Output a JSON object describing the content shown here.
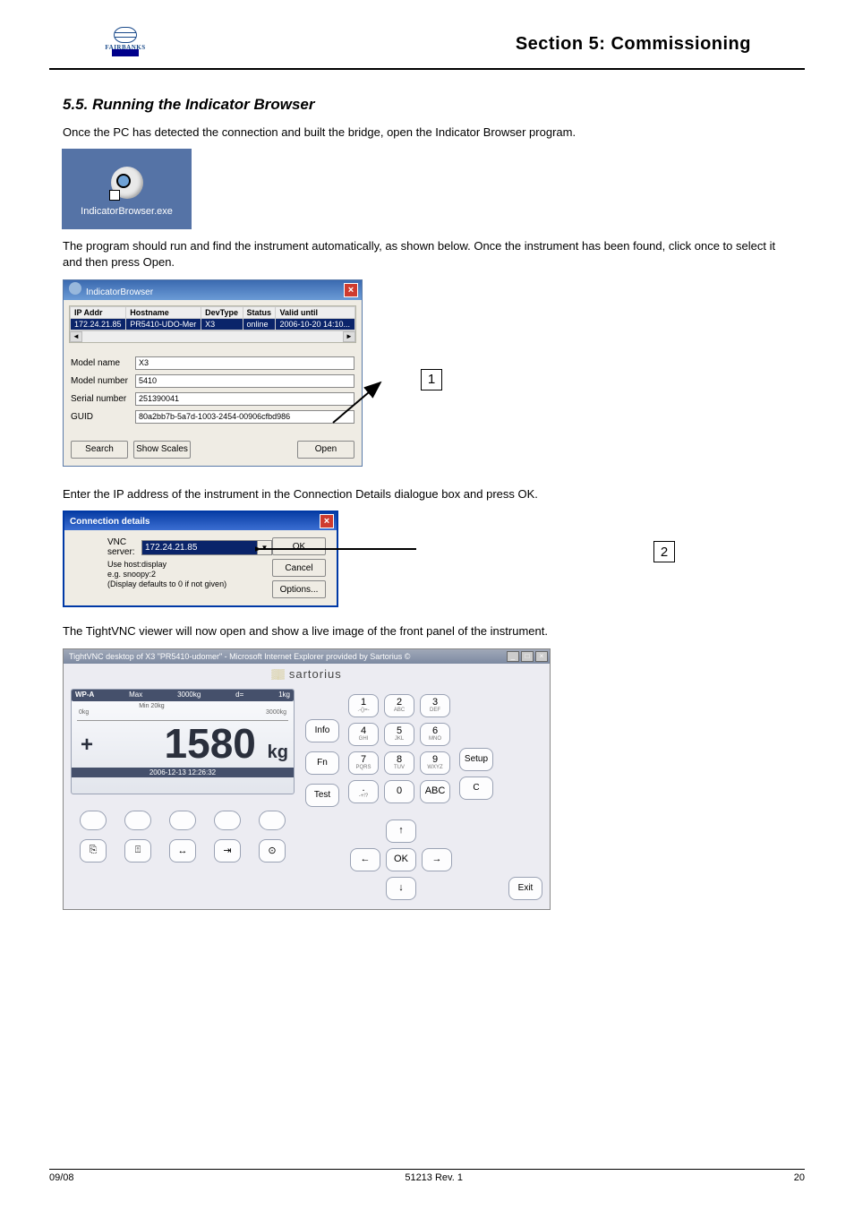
{
  "header": {
    "section_title": "Section 5: Commissioning"
  },
  "section55_heading": "5.5. Running the Indicator Browser",
  "intro_para": "Once the PC has detected the connection and built the bridge, open the Indicator Browser program.",
  "shortcut_label": "IndicatorBrowser.exe",
  "step1_para": "The program should run and find the instrument automatically, as shown below. Once the instrument has been found, click once to select it and then press Open.",
  "ib": {
    "title": "IndicatorBrowser",
    "columns": [
      "IP Addr",
      "Hostname",
      "DevType",
      "Status",
      "Valid until"
    ],
    "row": {
      "ip": "172.24.21.85",
      "host": "PR5410-UDO-Mer",
      "dev": "X3",
      "status": "online",
      "valid": "2006-10-20 14:10..."
    },
    "labels": {
      "model_name": "Model name",
      "model_number": "Model number",
      "serial_number": "Serial number",
      "guid": "GUID"
    },
    "values": {
      "model_name": "X3",
      "model_number": "5410",
      "serial_number": "251390041",
      "guid": "80a2bb7b-5a7d-1003-2454-00906cfbd986"
    },
    "buttons": {
      "search": "Search",
      "show_scales": "Show Scales",
      "open": "Open"
    }
  },
  "step2_para": "Enter the IP address of the instrument in the Connection Details dialogue box and press OK.",
  "cd": {
    "title": "Connection details",
    "label_server": "VNC server:",
    "value_server": "172.24.21.85",
    "help_line1": "Use host:display",
    "help_line2": "e.g. snoopy:2",
    "help_line3": "(Display defaults to 0 if not given)",
    "buttons": {
      "ok": "OK",
      "cancel": "Cancel",
      "options": "Options..."
    }
  },
  "step3_para": "The TightVNC viewer will now open and show a live image of the front panel of the instrument.",
  "vnc": {
    "title": "TightVNC desktop of X3 \"PR5410-udomer\" - Microsoft Internet Explorer provided by Sartorius ©",
    "brand": "sartorius",
    "topbar": {
      "wp": "WP-A",
      "max": "Max",
      "max2": "3000kg",
      "min": "Min",
      "min2": "20kg",
      "d": "d=",
      "dval": "1kg"
    },
    "scale": {
      "left": "0kg",
      "right": "3000kg"
    },
    "weight": "1580",
    "unit": "kg",
    "datetime": "2006-12-13  12:26:32",
    "left_buttons": {
      "info": "Info",
      "fn": "Fn",
      "test": "Test"
    },
    "keypad": [
      {
        "n": "1",
        "s": ".-()=-"
      },
      {
        "n": "2",
        "s": "ABC"
      },
      {
        "n": "3",
        "s": "DEF"
      },
      {
        "n": "4",
        "s": "GHI"
      },
      {
        "n": "5",
        "s": "JKL"
      },
      {
        "n": "6",
        "s": "MNO"
      },
      {
        "n": "7",
        "s": "PQRS"
      },
      {
        "n": "8",
        "s": "TUV"
      },
      {
        "n": "9",
        "s": "WXYZ"
      },
      {
        "n": ".",
        "s": "-+!?"
      },
      {
        "n": "0",
        "s": ""
      },
      {
        "n": "ABC",
        "s": ""
      }
    ],
    "side": {
      "setup": "Setup",
      "c": "C",
      "exit": "Exit"
    },
    "nav": {
      "ok": "OK",
      "up": "↑",
      "down": "↓",
      "left": "←",
      "right": "→"
    },
    "func_icons": [
      "⎘",
      "⍐",
      "↔",
      "⇥",
      "⊙"
    ]
  },
  "callouts": {
    "one": "1",
    "two": "2"
  },
  "footer": {
    "date": "09/08",
    "pub": "51213 Rev. 1",
    "page": "20"
  }
}
